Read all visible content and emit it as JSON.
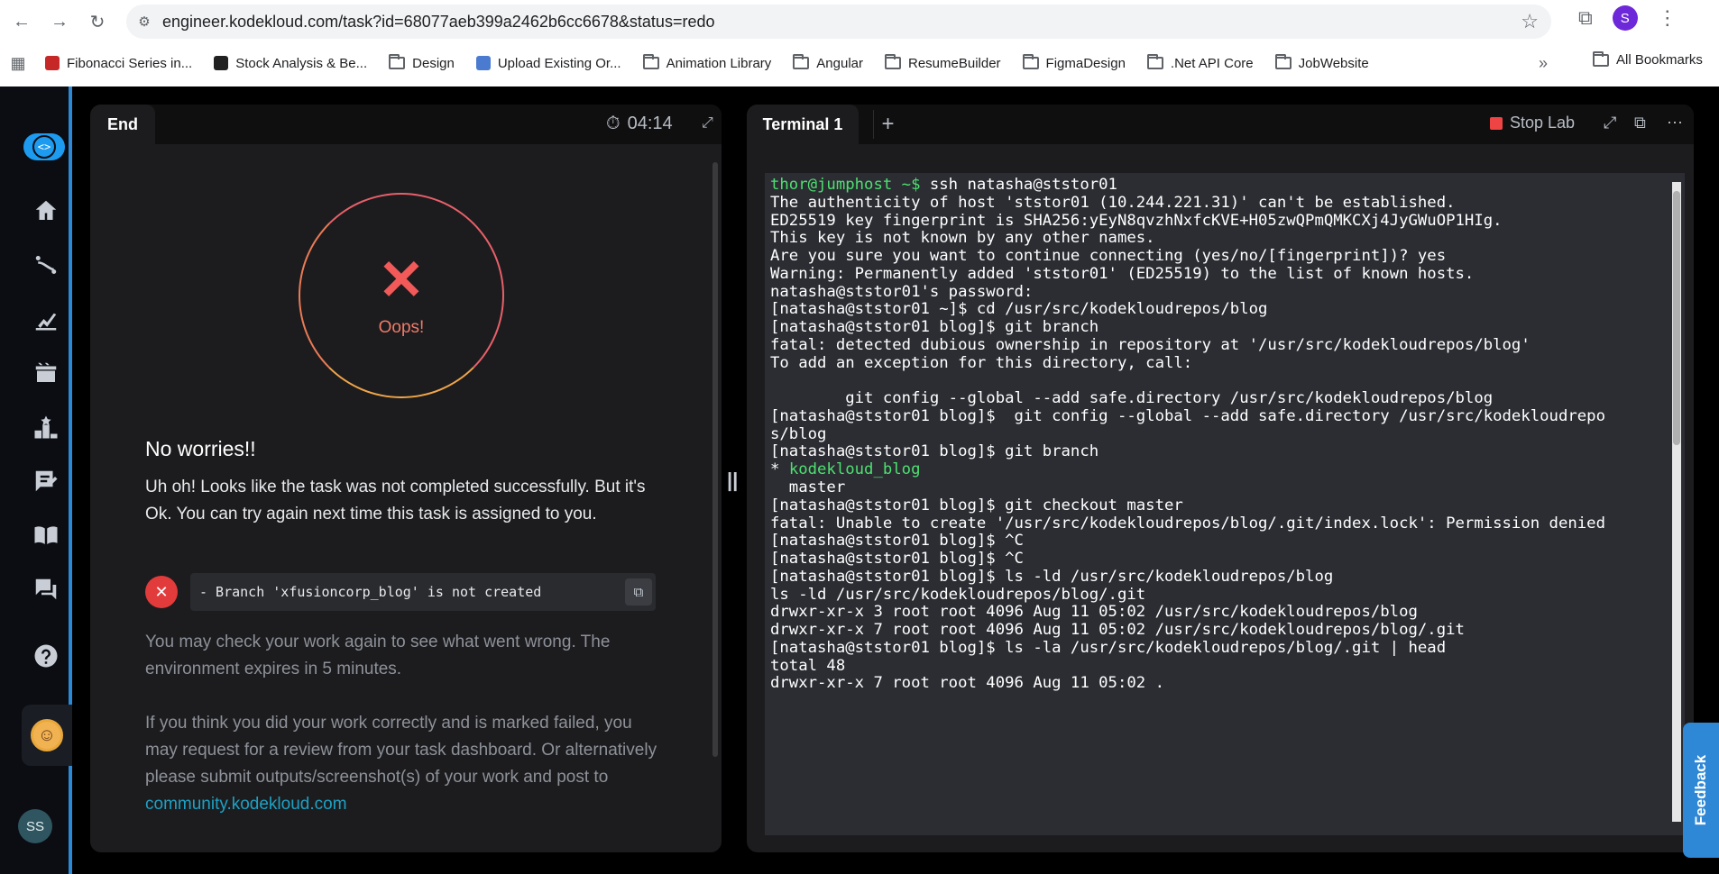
{
  "browser": {
    "url": "engineer.kodekloud.com/task?id=68077aeb399a2462b6cc6678&status=redo",
    "profile_initial": "S",
    "bookmarks": [
      {
        "label": "Fibonacci Series in...",
        "type": "site",
        "color": "#c62828"
      },
      {
        "label": "Stock Analysis & Be...",
        "type": "site",
        "color": "#212121"
      },
      {
        "label": "Design",
        "type": "folder"
      },
      {
        "label": "Upload Existing Or...",
        "type": "site",
        "color": "#4a7bd0"
      },
      {
        "label": "Animation Library",
        "type": "folder"
      },
      {
        "label": "Angular",
        "type": "folder"
      },
      {
        "label": "ResumeBuilder",
        "type": "folder"
      },
      {
        "label": "FigmaDesign",
        "type": "folder"
      },
      {
        "label": ".Net API Core",
        "type": "folder"
      },
      {
        "label": "JobWebsite",
        "type": "folder"
      }
    ],
    "more_bookmarks": "»",
    "all_bookmarks": "All Bookmarks"
  },
  "sidebar": {
    "icons": [
      "home-icon",
      "roadmap-icon",
      "progress-icon",
      "labs-icon",
      "leaderboard-icon",
      "notes-icon",
      "book-icon",
      "chat-icon",
      "help-icon"
    ],
    "user_initials": "SS"
  },
  "left_panel": {
    "tab_label": "End",
    "timer": "04:14",
    "status_text": "Oops!",
    "title": "No worries!!",
    "message": "Uh oh! Looks like the task was not completed successfully. But it's Ok. You can try again next time this task is assigned to you.",
    "error_item": "- Branch 'xfusioncorp_blog' is not created",
    "paragraph1": "You may check your work again to see what went wrong. The environment expires in 5 minutes.",
    "paragraph2": "If you think you did your work correctly and is marked failed, you may request for a review from your task dashboard. Or alternatively please submit outputs/screenshot(s) of your work and post to",
    "community_link": "community.kodekloud.com"
  },
  "right_panel": {
    "tab_label": "Terminal 1",
    "add_tab": "+",
    "stop_lab": "Stop Lab",
    "terminal_lines": [
      {
        "prompt": "thor@jumphost ~$",
        "text": " ssh natasha@ststor01"
      },
      {
        "text": "The authenticity of host 'ststor01 (10.244.221.31)' can't be established."
      },
      {
        "text": "ED25519 key fingerprint is SHA256:yEyN8qvzhNxfcKVE+H05zwQPmQMKCXj4JyGWuOP1HIg."
      },
      {
        "text": "This key is not known by any other names."
      },
      {
        "text": "Are you sure you want to continue connecting (yes/no/[fingerprint])? yes"
      },
      {
        "text": "Warning: Permanently added 'ststor01' (ED25519) to the list of known hosts."
      },
      {
        "text": "natasha@ststor01's password:"
      },
      {
        "text": "[natasha@ststor01 ~]$ cd /usr/src/kodekloudrepos/blog"
      },
      {
        "text": "[natasha@ststor01 blog]$ git branch"
      },
      {
        "text": "fatal: detected dubious ownership in repository at '/usr/src/kodekloudrepos/blog'"
      },
      {
        "text": "To add an exception for this directory, call:"
      },
      {
        "text": ""
      },
      {
        "text": "        git config --global --add safe.directory /usr/src/kodekloudrepos/blog"
      },
      {
        "text": "[natasha@ststor01 blog]$  git config --global --add safe.directory /usr/src/kodekloudrepo"
      },
      {
        "text": "s/blog"
      },
      {
        "text": "[natasha@ststor01 blog]$ git branch"
      },
      {
        "prefix": "* ",
        "green": "kodekloud_blog"
      },
      {
        "text": "  master"
      },
      {
        "text": "[natasha@ststor01 blog]$ git checkout master"
      },
      {
        "text": "fatal: Unable to create '/usr/src/kodekloudrepos/blog/.git/index.lock': Permission denied"
      },
      {
        "text": "[natasha@ststor01 blog]$ ^C"
      },
      {
        "text": "[natasha@ststor01 blog]$ ^C"
      },
      {
        "text": "[natasha@ststor01 blog]$ ls -ld /usr/src/kodekloudrepos/blog"
      },
      {
        "text": "ls -ld /usr/src/kodekloudrepos/blog/.git"
      },
      {
        "text": "drwxr-xr-x 3 root root 4096 Aug 11 05:02 /usr/src/kodekloudrepos/blog"
      },
      {
        "text": "drwxr-xr-x 7 root root 4096 Aug 11 05:02 /usr/src/kodekloudrepos/blog/.git"
      },
      {
        "text": "[natasha@ststor01 blog]$ ls -la /usr/src/kodekloudrepos/blog/.git | head"
      },
      {
        "text": "total 48"
      },
      {
        "text": "drwxr-xr-x 7 root root 4096 Aug 11 05:02 ."
      }
    ]
  },
  "feedback_label": "Feedback",
  "colors": {
    "accent": "#1d9bf0",
    "terminal_bg": "#2b2d33",
    "prompt_green": "#4ee070",
    "error_red": "#e23b3b",
    "link": "#1da1c4"
  }
}
